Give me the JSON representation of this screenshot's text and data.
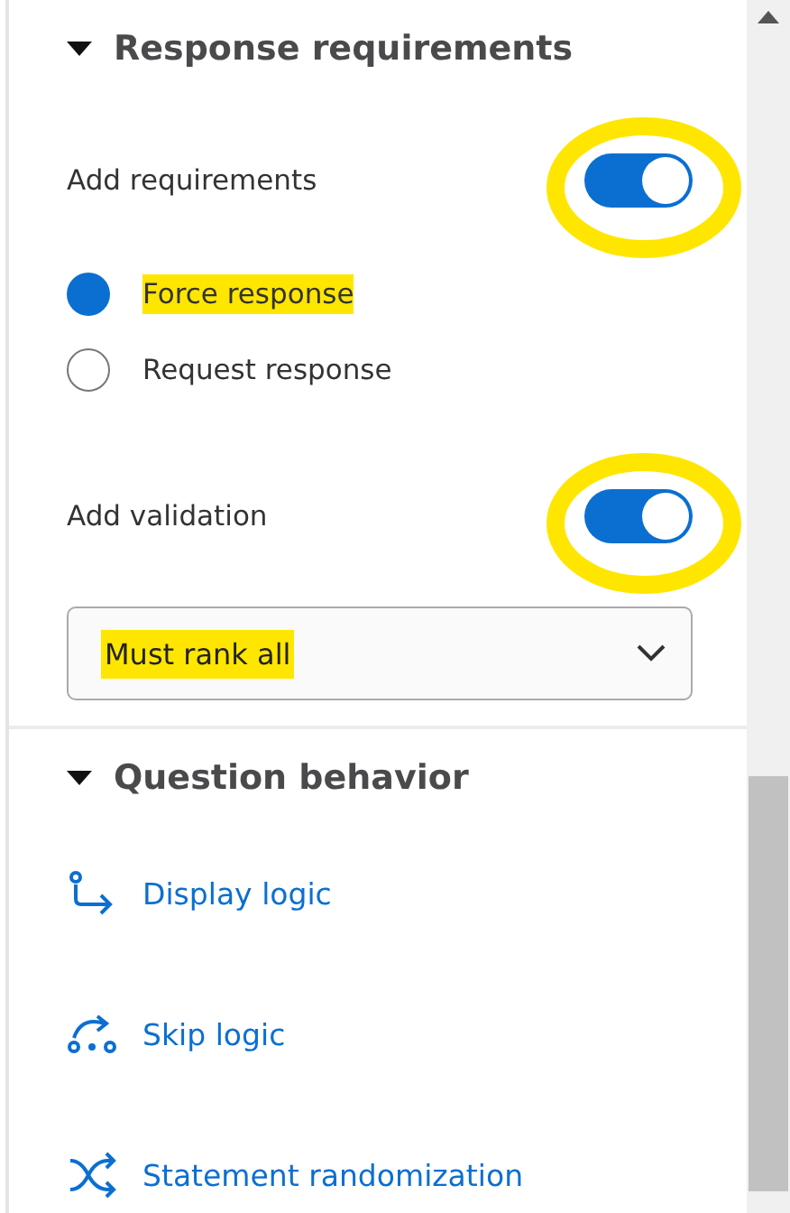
{
  "sections": [
    {
      "title": "Response requirements",
      "expanded": true,
      "kind": "settings",
      "toggles_before": [
        {
          "label": "Add requirements",
          "on": true,
          "highlighted": true
        }
      ],
      "radios": [
        {
          "label": "Force response",
          "selected": true,
          "highlighted": true
        },
        {
          "label": "Request response",
          "selected": false,
          "highlighted": false
        }
      ],
      "toggles_after": [
        {
          "label": "Add validation",
          "on": true,
          "highlighted": true
        }
      ],
      "select": {
        "value": "Must rank all",
        "highlighted": true
      }
    },
    {
      "title": "Question behavior",
      "expanded": true,
      "kind": "links",
      "links": [
        {
          "label": "Display logic",
          "kind": "display"
        },
        {
          "label": "Skip logic",
          "kind": "skip"
        },
        {
          "label": "Statement randomization",
          "kind": "randomize"
        }
      ]
    }
  ]
}
